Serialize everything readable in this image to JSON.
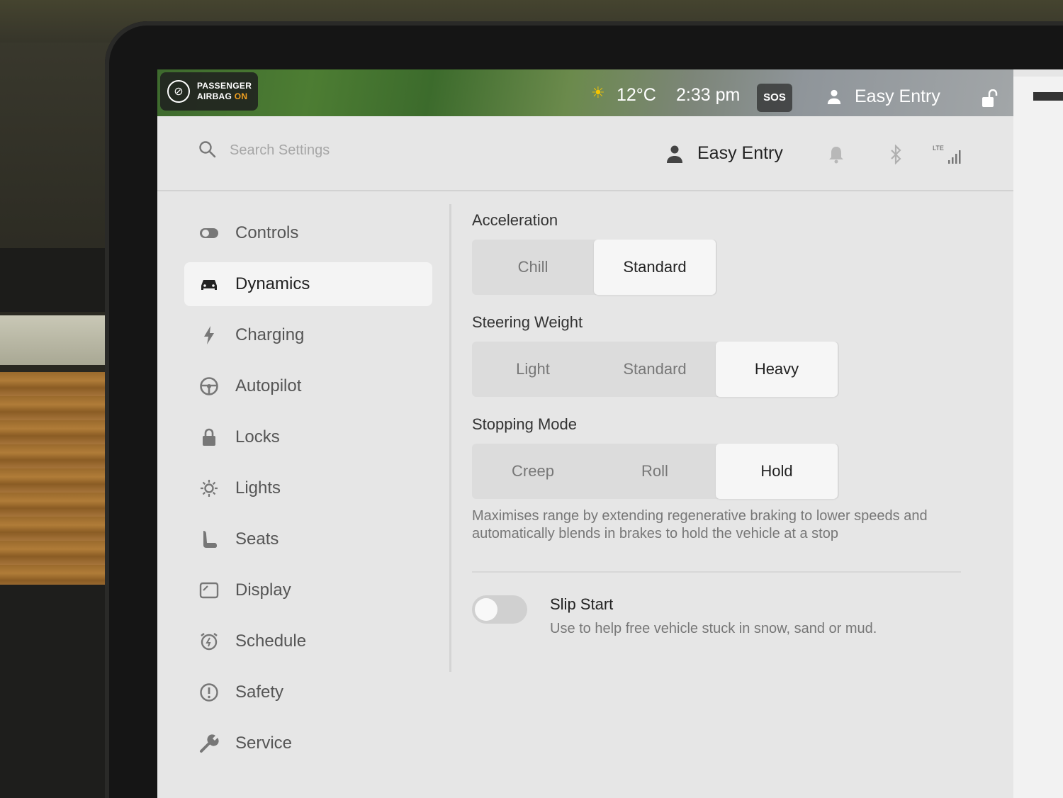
{
  "status_bar": {
    "airbag_line1": "PASSENGER",
    "airbag_line2_prefix": "AIRBAG ",
    "airbag_state": "ON",
    "temperature": "12°C",
    "time": "2:33 pm",
    "sos": "SOS",
    "driver_profile": "Easy Entry"
  },
  "header": {
    "search_placeholder": "Search Settings",
    "profile_name": "Easy Entry",
    "lte_label": "LTE"
  },
  "sidebar": {
    "items": [
      {
        "label": "Controls",
        "icon": "toggle-icon"
      },
      {
        "label": "Dynamics",
        "icon": "car-icon",
        "active": true
      },
      {
        "label": "Charging",
        "icon": "bolt-icon"
      },
      {
        "label": "Autopilot",
        "icon": "steering-wheel-icon"
      },
      {
        "label": "Locks",
        "icon": "lock-icon"
      },
      {
        "label": "Lights",
        "icon": "light-icon"
      },
      {
        "label": "Seats",
        "icon": "seat-icon"
      },
      {
        "label": "Display",
        "icon": "display-icon"
      },
      {
        "label": "Schedule",
        "icon": "alarm-clock-icon"
      },
      {
        "label": "Safety",
        "icon": "alert-icon"
      },
      {
        "label": "Service",
        "icon": "wrench-icon"
      }
    ]
  },
  "main": {
    "acceleration": {
      "title": "Acceleration",
      "options": [
        "Chill",
        "Standard"
      ],
      "selected": "Standard"
    },
    "steering_weight": {
      "title": "Steering Weight",
      "options": [
        "Light",
        "Standard",
        "Heavy"
      ],
      "selected": "Heavy"
    },
    "stopping_mode": {
      "title": "Stopping Mode",
      "options": [
        "Creep",
        "Roll",
        "Hold"
      ],
      "selected": "Hold",
      "description": "Maximises range by extending regenerative braking to lower speeds and automatically blends in brakes to hold the vehicle at a stop"
    },
    "slip_start": {
      "title": "Slip Start",
      "description": "Use to help free vehicle stuck in snow, sand or mud.",
      "enabled": false
    }
  },
  "colors": {
    "airbag_on": "#f0a020",
    "sun": "#f5c400",
    "screen_bg": "#e6e6e6",
    "selected_segment": "#f6f6f6"
  }
}
